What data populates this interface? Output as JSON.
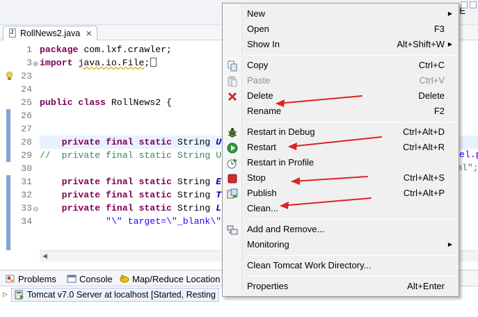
{
  "window": {
    "corner_text": "E"
  },
  "editor": {
    "tab_label": "RollNews2.java",
    "tab_close": "✕",
    "lines": [
      {
        "n": "1",
        "fold": "",
        "html_parts": [
          {
            "t": "package",
            "c": "kw"
          },
          {
            "t": " com.lxf.crawler;",
            "c": ""
          }
        ]
      },
      {
        "n": "3",
        "fold": "⊕",
        "html_parts": [
          {
            "t": "import",
            "c": "kw"
          },
          {
            "t": " ",
            "c": ""
          },
          {
            "t": "java.io.File",
            "c": "warn"
          },
          {
            "t": ";",
            "c": ""
          }
        ]
      },
      {
        "n": "23",
        "fold": "",
        "html_parts": []
      },
      {
        "n": "24",
        "fold": "",
        "html_parts": []
      },
      {
        "n": "25",
        "fold": "",
        "html_parts": [
          {
            "t": "public class",
            "c": "kw"
          },
          {
            "t": " RollNews2 {",
            "c": ""
          }
        ]
      },
      {
        "n": "26",
        "fold": "",
        "html_parts": []
      },
      {
        "n": "27",
        "fold": "",
        "html_parts": []
      },
      {
        "n": "28",
        "fold": "",
        "html_parts": [
          {
            "t": "    private final static",
            "c": "kw"
          },
          {
            "t": " String ",
            "c": ""
          },
          {
            "t": "U",
            "c": "ital"
          }
        ]
      },
      {
        "n": "29",
        "fold": "",
        "html_parts": [
          {
            "t": "//  private final static String U",
            "c": "cmt"
          }
        ]
      },
      {
        "n": "30",
        "fold": "",
        "html_parts": []
      },
      {
        "n": "31",
        "fold": "",
        "html_parts": [
          {
            "t": "    private final static",
            "c": "kw"
          },
          {
            "t": " String ",
            "c": ""
          },
          {
            "t": "E",
            "c": "ital"
          }
        ]
      },
      {
        "n": "32",
        "fold": "",
        "html_parts": [
          {
            "t": "    private final static",
            "c": "kw"
          },
          {
            "t": " String ",
            "c": ""
          },
          {
            "t": "T",
            "c": "ital"
          }
        ]
      },
      {
        "n": "33",
        "fold": "⊖",
        "html_parts": [
          {
            "t": "    private final static",
            "c": "kw"
          },
          {
            "t": " String ",
            "c": ""
          },
          {
            "t": "L",
            "c": "ital"
          }
        ]
      },
      {
        "n": "34",
        "fold": "",
        "html_parts": [
          {
            "t": "            \"\\\" target=\\\"_blank\\\"",
            "c": "str"
          }
        ]
      }
    ],
    "overflow_right_28": "el.p",
    "overflow_right_29": "ml\";"
  },
  "views": {
    "tabs": [
      {
        "label": "Problems",
        "icon": "problems-icon"
      },
      {
        "label": "Console",
        "icon": "console-icon"
      },
      {
        "label": "Map/Reduce Location",
        "icon": "map-reduce-icon"
      }
    ],
    "server_row": "Tomcat v7.0 Server at localhost  [Started, Resting"
  },
  "context_menu": {
    "items": [
      {
        "label": "New",
        "shortcut": "",
        "submenu": true,
        "icon": "",
        "disabled": false
      },
      {
        "label": "Open",
        "shortcut": "F3",
        "submenu": false,
        "icon": "",
        "disabled": false
      },
      {
        "label": "Show In",
        "shortcut": "Alt+Shift+W",
        "submenu": true,
        "icon": "",
        "disabled": false
      },
      {
        "label": "Copy",
        "shortcut": "Ctrl+C",
        "submenu": false,
        "icon": "copy-icon",
        "disabled": false
      },
      {
        "label": "Paste",
        "shortcut": "Ctrl+V",
        "submenu": false,
        "icon": "paste-icon",
        "disabled": true
      },
      {
        "label": "Delete",
        "shortcut": "Delete",
        "submenu": false,
        "icon": "delete-icon",
        "disabled": false
      },
      {
        "label": "Rename",
        "shortcut": "F2",
        "submenu": false,
        "icon": "",
        "disabled": false
      },
      {
        "label": "Restart in Debug",
        "shortcut": "Ctrl+Alt+D",
        "submenu": false,
        "icon": "debug-icon",
        "disabled": false
      },
      {
        "label": "Restart",
        "shortcut": "Ctrl+Alt+R",
        "submenu": false,
        "icon": "run-icon",
        "disabled": false
      },
      {
        "label": "Restart in Profile",
        "shortcut": "",
        "submenu": false,
        "icon": "profile-icon",
        "disabled": false
      },
      {
        "label": "Stop",
        "shortcut": "Ctrl+Alt+S",
        "submenu": false,
        "icon": "stop-icon",
        "disabled": false
      },
      {
        "label": "Publish",
        "shortcut": "Ctrl+Alt+P",
        "submenu": false,
        "icon": "publish-icon",
        "disabled": false
      },
      {
        "label": "Clean...",
        "shortcut": "",
        "submenu": false,
        "icon": "",
        "disabled": false
      },
      {
        "label": "Add and Remove...",
        "shortcut": "",
        "submenu": false,
        "icon": "add-remove-icon",
        "disabled": false
      },
      {
        "label": "Monitoring",
        "shortcut": "",
        "submenu": true,
        "icon": "",
        "disabled": false
      },
      {
        "label": "Clean Tomcat Work Directory...",
        "shortcut": "",
        "submenu": false,
        "icon": "",
        "disabled": false
      },
      {
        "label": "Properties",
        "shortcut": "Alt+Enter",
        "submenu": false,
        "icon": "",
        "disabled": false
      }
    ]
  },
  "colors": {
    "keyword": "#7f0055",
    "string": "#2a00ff",
    "comment": "#3f7f5f",
    "annotation_arrow": "#e02020"
  }
}
